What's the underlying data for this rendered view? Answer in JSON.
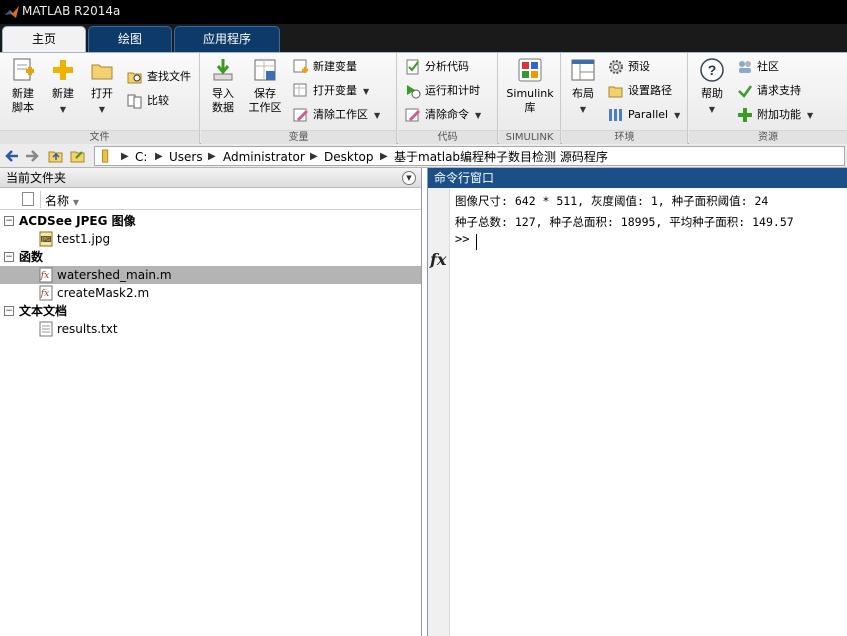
{
  "app": {
    "title": "MATLAB R2014a"
  },
  "tabs": [
    {
      "label": "主页",
      "active": true
    },
    {
      "label": "绘图",
      "active": false
    },
    {
      "label": "应用程序",
      "active": false
    }
  ],
  "ribbon": {
    "file": {
      "label": "文件",
      "new_script": "新建\n脚本",
      "new": "新建",
      "open": "打开",
      "find_files": "查找文件",
      "compare": "比较"
    },
    "variable": {
      "label": "变量",
      "import": "导入\n数据",
      "save_workspace": "保存\n工作区",
      "new_variable": "新建变量",
      "open_variable": "打开变量",
      "clear_workspace": "清除工作区"
    },
    "code": {
      "label": "代码",
      "analyze": "分析代码",
      "run_time": "运行和计时",
      "clear_commands": "清除命令"
    },
    "simulink": {
      "label": "SIMULINK",
      "library": "Simulink\n库"
    },
    "environment": {
      "label": "环境",
      "layout": "布局",
      "preferences": "预设",
      "set_path": "设置路径",
      "parallel": "Parallel"
    },
    "resources": {
      "label": "资源",
      "help": "帮助",
      "community": "社区",
      "request_support": "请求支持",
      "addons": "附加功能"
    }
  },
  "address": {
    "crumbs": [
      "C:",
      "Users",
      "Administrator",
      "Desktop",
      "基于matlab编程种子数目检测 源码程序"
    ]
  },
  "current_folder": {
    "title": "当前文件夹",
    "column_name": "名称",
    "groups": [
      {
        "label": "ACDSee JPEG 图像",
        "files": [
          {
            "name": "test1.jpg",
            "icon": "jpeg-file-icon",
            "selected": false
          }
        ]
      },
      {
        "label": "函数",
        "files": [
          {
            "name": "watershed_main.m",
            "icon": "matlab-function-icon",
            "selected": true
          },
          {
            "name": "createMask2.m",
            "icon": "matlab-function-icon",
            "selected": false
          }
        ]
      },
      {
        "label": "文本文档",
        "files": [
          {
            "name": "results.txt",
            "icon": "text-file-icon",
            "selected": false
          }
        ]
      }
    ]
  },
  "command_window": {
    "title": "命令行窗口",
    "lines": [
      "图像尺寸: 642 * 511, 灰度阈值: 1, 种子面积阈值: 24",
      "种子总数: 127, 种子总面积: 18995, 平均种子面积: 149.57"
    ],
    "prompt": ">>"
  }
}
